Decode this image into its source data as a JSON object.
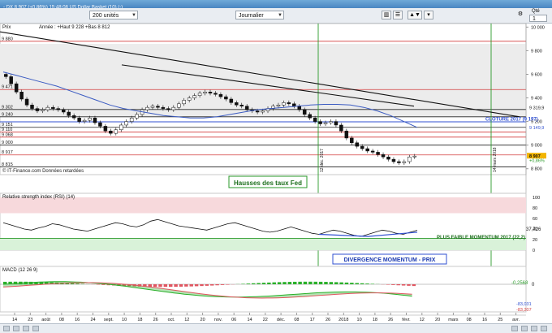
{
  "window": {
    "title": "- DX   8 907 (+0,86%)  15:48:08 US Dollar Basket (10) (-)",
    "symbol": "DX",
    "last": "8 907",
    "change": "+0,86%",
    "time": "15:48:08",
    "name": "US Dollar Basket (10) (-)"
  },
  "toolbar": {
    "quantity": "200 unités",
    "period": "Journalier",
    "right_label": "Qté",
    "right_value": "1"
  },
  "main_panel": {
    "title": "Prix",
    "range_text": "Année : +Haut 9 228 +Bas 8 812",
    "source_text": "© IT-Finance.com Données retardées",
    "hline_labels": [
      {
        "value": 9880,
        "label": "9 880",
        "color": "#d23c3c"
      },
      {
        "value": 9471,
        "label": "9 471",
        "color": "#d23c3c"
      },
      {
        "value": 9302,
        "label": "9 302",
        "color": "#222222"
      },
      {
        "value": 9240,
        "label": "9 240",
        "color": "#222222"
      },
      {
        "value": 9151,
        "label": "9 151",
        "color": "#222222"
      },
      {
        "value": 9110,
        "label": "9 110",
        "color": "#d23c3c"
      },
      {
        "value": 9068,
        "label": "9 068",
        "color": "#d23c3c"
      },
      {
        "value": 9000,
        "label": "9 000",
        "color": "#222222"
      },
      {
        "value": 8917,
        "label": "8 917",
        "color": "#d23c3c"
      },
      {
        "value": 8815,
        "label": "8 815",
        "color": "#222222"
      }
    ],
    "yticks": [
      {
        "value": 10000,
        "label": "10 000"
      },
      {
        "value": 9800,
        "label": "9 800"
      },
      {
        "value": 9600,
        "label": "9 600"
      },
      {
        "value": 9400,
        "label": "9 400"
      },
      {
        "value": 9200,
        "label": "9 200"
      },
      {
        "value": 9000,
        "label": "9 000"
      },
      {
        "value": 8800,
        "label": "8 800"
      }
    ],
    "right_labels": [
      {
        "value": 9319,
        "label": "9 319,9"
      },
      {
        "value": 9149,
        "label": "9 149,9"
      },
      {
        "value": 8907,
        "label": "8 907"
      },
      {
        "value": 8870,
        "label": "+0,86%"
      }
    ],
    "cloture_label": "CLOTURE 2017 (9 197)",
    "vline_labels": [
      "12 déc. 2017",
      "14 mars 2018"
    ],
    "annotation": "Hausses des taux Fed"
  },
  "rsi_panel": {
    "title": "Relative strength index (RSI) (14)",
    "yticks": [
      "100",
      "80",
      "60",
      "40",
      "20",
      "0"
    ],
    "value_label": "37,726",
    "level_label": "PLUS FAIBLE MOMENTUM 2017 (22,2)",
    "divergence_label": "DIVERGENCE MOMENTUM - PRIX"
  },
  "macd_panel": {
    "title": "MACD (12 26 9)",
    "yticks": [
      "0",
      "-83,031"
    ],
    "label_a": "-0,2568",
    "label_b": "-83,031",
    "label_c": "-83,207"
  },
  "xaxis": {
    "labels": [
      "14",
      "23",
      "août",
      "08",
      "16",
      "24",
      "sept.",
      "10",
      "18",
      "26",
      "oct.",
      "12",
      "20",
      "nov.",
      "06",
      "14",
      "22",
      "déc.",
      "08",
      "17",
      "26",
      "2018",
      "10",
      "18",
      "26",
      "févr.",
      "12",
      "20",
      "mars",
      "08",
      "16",
      "25",
      "avr."
    ]
  },
  "colors": {
    "up": "#ffffff",
    "down": "#111111",
    "resistance": "#d23c3c",
    "moving_average": "#3b5bc2",
    "trend": "#111111",
    "vline": "#2a9a2a",
    "cloture": "#3050d0",
    "annotation_box": "#2a9a2a",
    "divergence_box": "#3050d0",
    "rsi_band": "#f7d9dc",
    "rsi_low_band": "#d9f2d9",
    "macd_signal": "#e05560",
    "macd_line": "#2ab02a"
  },
  "chart_data": {
    "type": "candlestick",
    "title": "US Dollar Basket (10)",
    "ylim": [
      8750,
      10030
    ],
    "x_labels": [
      "14",
      "23",
      "août",
      "08",
      "16",
      "24",
      "sept.",
      "10",
      "18",
      "26",
      "oct.",
      "12",
      "20",
      "nov.",
      "06",
      "14",
      "22",
      "déc.",
      "08",
      "17",
      "26",
      "2018",
      "10",
      "18",
      "26",
      "févr.",
      "12",
      "20",
      "mars",
      "08",
      "16",
      "25",
      "avr."
    ],
    "price_close_path": [
      9580,
      9520,
      9450,
      9390,
      9340,
      9310,
      9290,
      9300,
      9320,
      9310,
      9300,
      9280,
      9250,
      9230,
      9200,
      9210,
      9230,
      9190,
      9160,
      9120,
      9100,
      9130,
      9170,
      9200,
      9230,
      9260,
      9300,
      9320,
      9330,
      9320,
      9310,
      9300,
      9320,
      9350,
      9380,
      9400,
      9420,
      9440,
      9450,
      9440,
      9430,
      9410,
      9390,
      9360,
      9340,
      9330,
      9300,
      9290,
      9280,
      9290,
      9310,
      9330,
      9340,
      9360,
      9350,
      9330,
      9300,
      9260,
      9230,
      9200,
      9180,
      9190,
      9200,
      9170,
      9120,
      9060,
      9020,
      8990,
      8970,
      8950,
      8940,
      8920,
      8900,
      8880,
      8860,
      8850,
      8860,
      8900,
      8907
    ],
    "moving_average_40": [
      9620,
      9590,
      9560,
      9530,
      9500,
      9460,
      9420,
      9380,
      9340,
      9310,
      9290,
      9270,
      9250,
      9240,
      9230,
      9230,
      9240,
      9260,
      9280,
      9300,
      9310,
      9320,
      9330,
      9340,
      9345,
      9345,
      9340,
      9320,
      9290,
      9250,
      9200,
      9150
    ],
    "resistance_levels": [
      9880,
      9471,
      9302,
      9240,
      9151,
      9110,
      9068,
      9000,
      8917,
      8815
    ],
    "cloture_2017": 9197,
    "last": 8907,
    "change_pct": 0.86,
    "rsi_14": [
      52,
      48,
      44,
      40,
      38,
      42,
      45,
      50,
      48,
      44,
      40,
      38,
      36,
      40,
      44,
      48,
      52,
      50,
      46,
      44,
      48,
      55,
      58,
      54,
      50,
      46,
      44,
      42,
      40,
      38,
      42,
      46,
      50,
      52,
      48,
      44,
      40,
      36,
      34,
      36,
      40,
      44,
      40,
      36,
      32,
      30,
      34,
      38,
      36,
      32,
      28,
      26,
      30,
      34,
      38,
      36,
      32,
      30,
      34,
      37.7
    ],
    "rsi_last": 37.726,
    "rsi_low_2017": 22.2,
    "macd_last": -0.2568
  }
}
